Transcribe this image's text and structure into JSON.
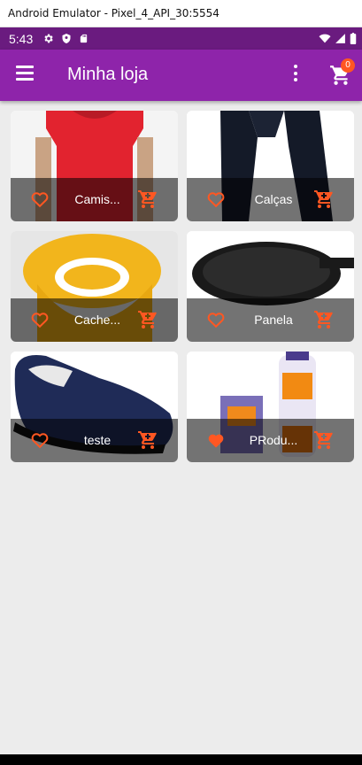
{
  "window": {
    "title": "Android Emulator - Pixel_4_API_30:5554"
  },
  "status_bar": {
    "time": "5:43",
    "icons_left": [
      "gear-icon",
      "shield-icon",
      "sd-card-icon"
    ],
    "icons_right": [
      "wifi-icon",
      "signal-icon",
      "battery-icon"
    ]
  },
  "app_bar": {
    "title": "Minha loja",
    "cart_badge": "0"
  },
  "colors": {
    "primary": "#8e24aa",
    "status": "#6a1b7f",
    "accent": "#ff5722"
  },
  "products": [
    {
      "name": "Camis...",
      "favorite": false,
      "image": "red t-shirt"
    },
    {
      "name": "Calças",
      "favorite": false,
      "image": "black pants"
    },
    {
      "name": "Cache...",
      "favorite": false,
      "image": "yellow scarf"
    },
    {
      "name": "Panela",
      "favorite": false,
      "image": "frying pan"
    },
    {
      "name": "teste",
      "favorite": false,
      "image": "navy shoe"
    },
    {
      "name": "PRodu...",
      "favorite": true,
      "image": "insect repellent"
    }
  ]
}
